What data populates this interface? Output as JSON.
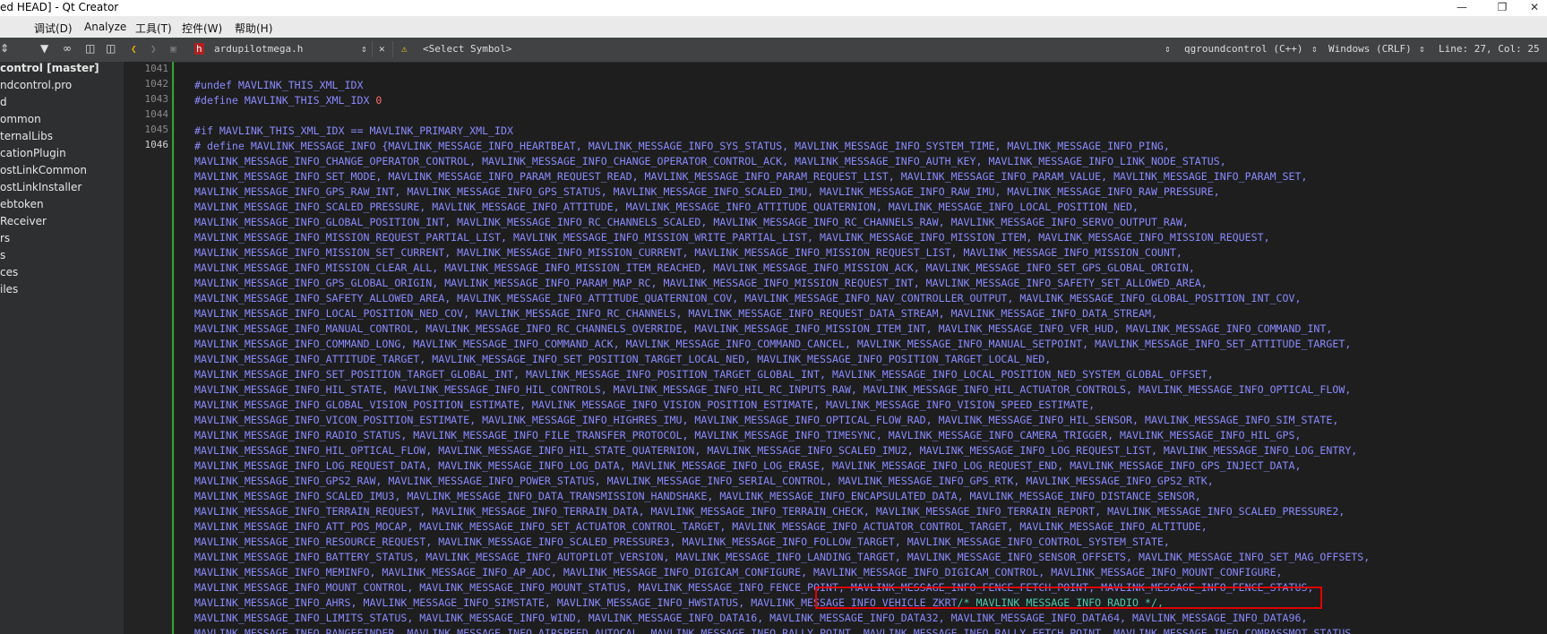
{
  "window": {
    "title": "ed HEAD] - Qt Creator"
  },
  "menu": [
    "调试(D)",
    "Analyze",
    "工具(T)",
    "控件(W)",
    "帮助(H)"
  ],
  "sidebar": {
    "items": [
      {
        "label": "control [master]",
        "bold": true
      },
      {
        "label": "ndcontrol.pro"
      },
      {
        "label": "d"
      },
      {
        "label": "ommon"
      },
      {
        "label": "ternalLibs"
      },
      {
        "label": "cationPlugin"
      },
      {
        "label": "ostLinkCommon"
      },
      {
        "label": "ostLinkInstaller"
      },
      {
        "label": "ebtoken"
      },
      {
        "label": "Receiver"
      },
      {
        "label": "rs"
      },
      {
        "label": "s"
      },
      {
        "label": "ces"
      },
      {
        "label": "iles"
      }
    ]
  },
  "editor": {
    "file_name": "ardupilotmega.h",
    "symbol": "<Select Symbol>",
    "project": "qgroundcontrol (C++)",
    "line_ending": "Windows (CRLF)",
    "cursor": "Line: 27, Col: 25",
    "line_numbers": [
      "1041",
      "1042",
      "1043",
      "1044",
      "1045",
      "1046"
    ],
    "lines": [
      {
        "text": ""
      },
      {
        "text": "#undef MAVLINK_THIS_XML_IDX"
      },
      {
        "text": "#define MAVLINK_THIS_XML_IDX ",
        "num": "0"
      },
      {
        "text": ""
      },
      {
        "text": "#if MAVLINK_THIS_XML_IDX == MAVLINK_PRIMARY_XML_IDX"
      },
      {
        "text": "# define MAVLINK_MESSAGE_INFO {MAVLINK_MESSAGE_INFO_HEARTBEAT, MAVLINK_MESSAGE_INFO_SYS_STATUS, MAVLINK_MESSAGE_INFO_SYSTEM_TIME, MAVLINK_MESSAGE_INFO_PING,"
      },
      {
        "text": "MAVLINK_MESSAGE_INFO_CHANGE_OPERATOR_CONTROL, MAVLINK_MESSAGE_INFO_CHANGE_OPERATOR_CONTROL_ACK, MAVLINK_MESSAGE_INFO_AUTH_KEY, MAVLINK_MESSAGE_INFO_LINK_NODE_STATUS,"
      },
      {
        "text": "MAVLINK_MESSAGE_INFO_SET_MODE, MAVLINK_MESSAGE_INFO_PARAM_REQUEST_READ, MAVLINK_MESSAGE_INFO_PARAM_REQUEST_LIST, MAVLINK_MESSAGE_INFO_PARAM_VALUE, MAVLINK_MESSAGE_INFO_PARAM_SET,"
      },
      {
        "text": "MAVLINK_MESSAGE_INFO_GPS_RAW_INT, MAVLINK_MESSAGE_INFO_GPS_STATUS, MAVLINK_MESSAGE_INFO_SCALED_IMU, MAVLINK_MESSAGE_INFO_RAW_IMU, MAVLINK_MESSAGE_INFO_RAW_PRESSURE,"
      },
      {
        "text": "MAVLINK_MESSAGE_INFO_SCALED_PRESSURE, MAVLINK_MESSAGE_INFO_ATTITUDE, MAVLINK_MESSAGE_INFO_ATTITUDE_QUATERNION, MAVLINK_MESSAGE_INFO_LOCAL_POSITION_NED,"
      },
      {
        "text": "MAVLINK_MESSAGE_INFO_GLOBAL_POSITION_INT, MAVLINK_MESSAGE_INFO_RC_CHANNELS_SCALED, MAVLINK_MESSAGE_INFO_RC_CHANNELS_RAW, MAVLINK_MESSAGE_INFO_SERVO_OUTPUT_RAW,"
      },
      {
        "text": "MAVLINK_MESSAGE_INFO_MISSION_REQUEST_PARTIAL_LIST, MAVLINK_MESSAGE_INFO_MISSION_WRITE_PARTIAL_LIST, MAVLINK_MESSAGE_INFO_MISSION_ITEM, MAVLINK_MESSAGE_INFO_MISSION_REQUEST,"
      },
      {
        "text": "MAVLINK_MESSAGE_INFO_MISSION_SET_CURRENT, MAVLINK_MESSAGE_INFO_MISSION_CURRENT, MAVLINK_MESSAGE_INFO_MISSION_REQUEST_LIST, MAVLINK_MESSAGE_INFO_MISSION_COUNT,"
      },
      {
        "text": "MAVLINK_MESSAGE_INFO_MISSION_CLEAR_ALL, MAVLINK_MESSAGE_INFO_MISSION_ITEM_REACHED, MAVLINK_MESSAGE_INFO_MISSION_ACK, MAVLINK_MESSAGE_INFO_SET_GPS_GLOBAL_ORIGIN,"
      },
      {
        "text": "MAVLINK_MESSAGE_INFO_GPS_GLOBAL_ORIGIN, MAVLINK_MESSAGE_INFO_PARAM_MAP_RC, MAVLINK_MESSAGE_INFO_MISSION_REQUEST_INT, MAVLINK_MESSAGE_INFO_SAFETY_SET_ALLOWED_AREA,"
      },
      {
        "text": "MAVLINK_MESSAGE_INFO_SAFETY_ALLOWED_AREA, MAVLINK_MESSAGE_INFO_ATTITUDE_QUATERNION_COV, MAVLINK_MESSAGE_INFO_NAV_CONTROLLER_OUTPUT, MAVLINK_MESSAGE_INFO_GLOBAL_POSITION_INT_COV,"
      },
      {
        "text": "MAVLINK_MESSAGE_INFO_LOCAL_POSITION_NED_COV, MAVLINK_MESSAGE_INFO_RC_CHANNELS, MAVLINK_MESSAGE_INFO_REQUEST_DATA_STREAM, MAVLINK_MESSAGE_INFO_DATA_STREAM,"
      },
      {
        "text": "MAVLINK_MESSAGE_INFO_MANUAL_CONTROL, MAVLINK_MESSAGE_INFO_RC_CHANNELS_OVERRIDE, MAVLINK_MESSAGE_INFO_MISSION_ITEM_INT, MAVLINK_MESSAGE_INFO_VFR_HUD, MAVLINK_MESSAGE_INFO_COMMAND_INT,"
      },
      {
        "text": "MAVLINK_MESSAGE_INFO_COMMAND_LONG, MAVLINK_MESSAGE_INFO_COMMAND_ACK, MAVLINK_MESSAGE_INFO_COMMAND_CANCEL, MAVLINK_MESSAGE_INFO_MANUAL_SETPOINT, MAVLINK_MESSAGE_INFO_SET_ATTITUDE_TARGET,"
      },
      {
        "text": "MAVLINK_MESSAGE_INFO_ATTITUDE_TARGET, MAVLINK_MESSAGE_INFO_SET_POSITION_TARGET_LOCAL_NED, MAVLINK_MESSAGE_INFO_POSITION_TARGET_LOCAL_NED,"
      },
      {
        "text": "MAVLINK_MESSAGE_INFO_SET_POSITION_TARGET_GLOBAL_INT, MAVLINK_MESSAGE_INFO_POSITION_TARGET_GLOBAL_INT, MAVLINK_MESSAGE_INFO_LOCAL_POSITION_NED_SYSTEM_GLOBAL_OFFSET,"
      },
      {
        "text": "MAVLINK_MESSAGE_INFO_HIL_STATE, MAVLINK_MESSAGE_INFO_HIL_CONTROLS, MAVLINK_MESSAGE_INFO_HIL_RC_INPUTS_RAW, MAVLINK_MESSAGE_INFO_HIL_ACTUATOR_CONTROLS, MAVLINK_MESSAGE_INFO_OPTICAL_FLOW,"
      },
      {
        "text": "MAVLINK_MESSAGE_INFO_GLOBAL_VISION_POSITION_ESTIMATE, MAVLINK_MESSAGE_INFO_VISION_POSITION_ESTIMATE, MAVLINK_MESSAGE_INFO_VISION_SPEED_ESTIMATE,"
      },
      {
        "text": "MAVLINK_MESSAGE_INFO_VICON_POSITION_ESTIMATE, MAVLINK_MESSAGE_INFO_HIGHRES_IMU, MAVLINK_MESSAGE_INFO_OPTICAL_FLOW_RAD, MAVLINK_MESSAGE_INFO_HIL_SENSOR, MAVLINK_MESSAGE_INFO_SIM_STATE,"
      },
      {
        "text": "MAVLINK_MESSAGE_INFO_RADIO_STATUS, MAVLINK_MESSAGE_INFO_FILE_TRANSFER_PROTOCOL, MAVLINK_MESSAGE_INFO_TIMESYNC, MAVLINK_MESSAGE_INFO_CAMERA_TRIGGER, MAVLINK_MESSAGE_INFO_HIL_GPS,"
      },
      {
        "text": "MAVLINK_MESSAGE_INFO_HIL_OPTICAL_FLOW, MAVLINK_MESSAGE_INFO_HIL_STATE_QUATERNION, MAVLINK_MESSAGE_INFO_SCALED_IMU2, MAVLINK_MESSAGE_INFO_LOG_REQUEST_LIST, MAVLINK_MESSAGE_INFO_LOG_ENTRY,"
      },
      {
        "text": "MAVLINK_MESSAGE_INFO_LOG_REQUEST_DATA, MAVLINK_MESSAGE_INFO_LOG_DATA, MAVLINK_MESSAGE_INFO_LOG_ERASE, MAVLINK_MESSAGE_INFO_LOG_REQUEST_END, MAVLINK_MESSAGE_INFO_GPS_INJECT_DATA,"
      },
      {
        "text": "MAVLINK_MESSAGE_INFO_GPS2_RAW, MAVLINK_MESSAGE_INFO_POWER_STATUS, MAVLINK_MESSAGE_INFO_SERIAL_CONTROL, MAVLINK_MESSAGE_INFO_GPS_RTK, MAVLINK_MESSAGE_INFO_GPS2_RTK,"
      },
      {
        "text": "MAVLINK_MESSAGE_INFO_SCALED_IMU3, MAVLINK_MESSAGE_INFO_DATA_TRANSMISSION_HANDSHAKE, MAVLINK_MESSAGE_INFO_ENCAPSULATED_DATA, MAVLINK_MESSAGE_INFO_DISTANCE_SENSOR,"
      },
      {
        "text": "MAVLINK_MESSAGE_INFO_TERRAIN_REQUEST, MAVLINK_MESSAGE_INFO_TERRAIN_DATA, MAVLINK_MESSAGE_INFO_TERRAIN_CHECK, MAVLINK_MESSAGE_INFO_TERRAIN_REPORT, MAVLINK_MESSAGE_INFO_SCALED_PRESSURE2,"
      },
      {
        "text": "MAVLINK_MESSAGE_INFO_ATT_POS_MOCAP, MAVLINK_MESSAGE_INFO_SET_ACTUATOR_CONTROL_TARGET, MAVLINK_MESSAGE_INFO_ACTUATOR_CONTROL_TARGET, MAVLINK_MESSAGE_INFO_ALTITUDE,"
      },
      {
        "text": "MAVLINK_MESSAGE_INFO_RESOURCE_REQUEST, MAVLINK_MESSAGE_INFO_SCALED_PRESSURE3, MAVLINK_MESSAGE_INFO_FOLLOW_TARGET, MAVLINK_MESSAGE_INFO_CONTROL_SYSTEM_STATE,"
      },
      {
        "text": "MAVLINK_MESSAGE_INFO_BATTERY_STATUS, MAVLINK_MESSAGE_INFO_AUTOPILOT_VERSION, MAVLINK_MESSAGE_INFO_LANDING_TARGET, MAVLINK_MESSAGE_INFO_SENSOR_OFFSETS, MAVLINK_MESSAGE_INFO_SET_MAG_OFFSETS,"
      },
      {
        "text": "MAVLINK_MESSAGE_INFO_MEMINFO, MAVLINK_MESSAGE_INFO_AP_ADC, MAVLINK_MESSAGE_INFO_DIGICAM_CONFIGURE, MAVLINK_MESSAGE_INFO_DIGICAM_CONTROL, MAVLINK_MESSAGE_INFO_MOUNT_CONFIGURE,"
      },
      {
        "text": "MAVLINK_MESSAGE_INFO_MOUNT_CONTROL, MAVLINK_MESSAGE_INFO_MOUNT_STATUS, MAVLINK_MESSAGE_INFO_FENCE_POINT, MAVLINK_MESSAGE_INFO_FENCE_FETCH_POINT, MAVLINK_MESSAGE_INFO_FENCE_STATUS,"
      },
      {
        "text": "MAVLINK_MESSAGE_INFO_AHRS, MAVLINK_MESSAGE_INFO_SIMSTATE, MAVLINK_MESSAGE_INFO_HWSTATUS, MAVLINK_MESSAGE_INFO_VEHICLE_ZKRT",
        "hl": "/* MAVLINK_MESSAGE_INFO_RADIO */,"
      },
      {
        "text": "MAVLINK_MESSAGE_INFO_LIMITS_STATUS, MAVLINK_MESSAGE_INFO_WIND, MAVLINK_MESSAGE_INFO_DATA16, MAVLINK_MESSAGE_INFO_DATA32, MAVLINK_MESSAGE_INFO_DATA64, MAVLINK_MESSAGE_INFO_DATA96,"
      },
      {
        "text": "MAVLINK_MESSAGE_INFO_RANGEFINDER, MAVLINK_MESSAGE_INFO_AIRSPEED_AUTOCAL, MAVLINK_MESSAGE_INFO_RALLY_POINT, MAVLINK_MESSAGE_INFO_RALLY_FETCH_POINT, MAVLINK_MESSAGE_INFO_COMPASSMOT_STATUS,"
      }
    ]
  },
  "colors": {
    "code": "#8a8aff",
    "number": "#ff6b6b",
    "comment": "#4ec9b0",
    "highlight_box": "#e00000",
    "change_bar": "#2fa52f"
  }
}
